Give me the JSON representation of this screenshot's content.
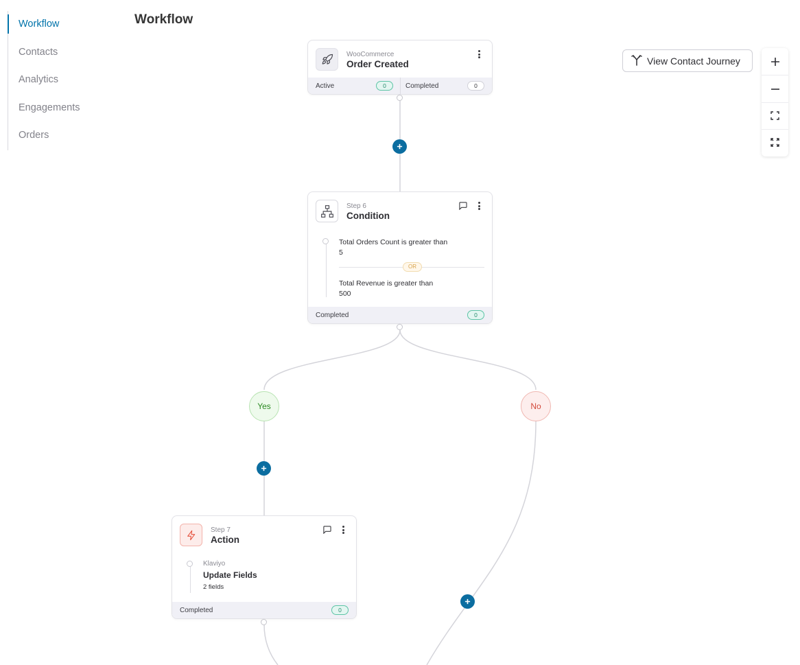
{
  "sidebar": {
    "items": [
      {
        "label": "Workflow",
        "active": true
      },
      {
        "label": "Contacts"
      },
      {
        "label": "Analytics"
      },
      {
        "label": "Engagements"
      },
      {
        "label": "Orders"
      }
    ]
  },
  "page": {
    "title": "Workflow"
  },
  "toolbar": {
    "journey_label": "View Contact Journey",
    "journey_icon": "branch-split-icon",
    "zoom_controls": [
      "zoom-in-icon",
      "zoom-out-icon",
      "fit-screen-icon",
      "fullscreen-icon"
    ]
  },
  "trigger": {
    "source": "WooCommerce",
    "title": "Order Created",
    "icon": "rocket-icon",
    "active_label": "Active",
    "active_count": "0",
    "completed_label": "Completed",
    "completed_count": "0"
  },
  "condition": {
    "step": "Step 6",
    "title": "Condition",
    "icon": "sitemap-icon",
    "rules": [
      {
        "text": "Total Orders Count is greater than",
        "value": "5"
      },
      {
        "text": "Total Revenue is greater than",
        "value": "500"
      }
    ],
    "or_label": "OR",
    "completed_label": "Completed",
    "completed_count": "0"
  },
  "branches": {
    "yes": "Yes",
    "no": "No"
  },
  "action": {
    "step": "Step 7",
    "title": "Action",
    "icon": "lightning-icon",
    "integration": "Klaviyo",
    "name": "Update Fields",
    "detail": "2 fields",
    "completed_label": "Completed",
    "completed_count": "0"
  },
  "colors": {
    "accent": "#0073aa",
    "add_button": "#0b6da0",
    "yes": "#2c8a23",
    "no": "#d24a3c",
    "action_icon": "#e5533f"
  }
}
